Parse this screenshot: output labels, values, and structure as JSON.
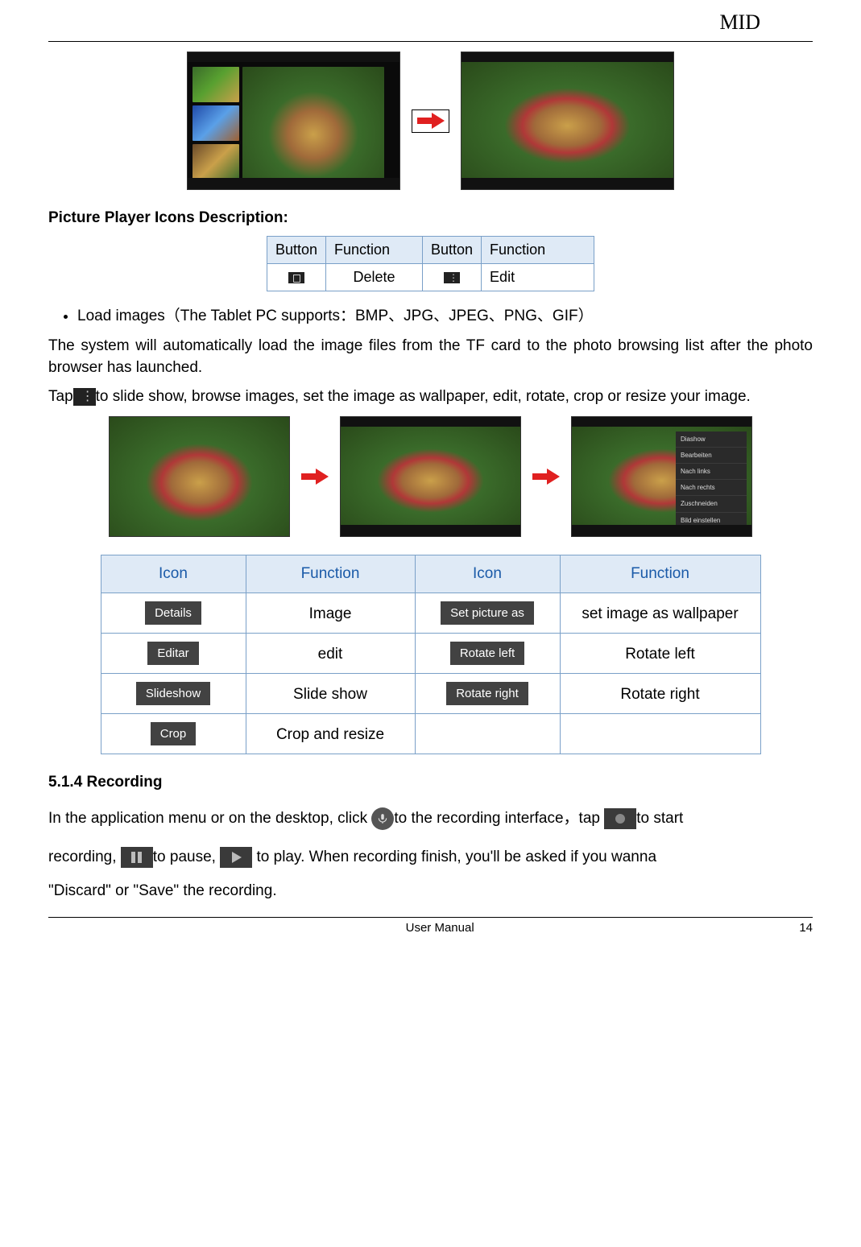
{
  "header": {
    "title": "MID"
  },
  "section_picture_desc": "Picture Player Icons Description:",
  "small_table": {
    "h1": "Button",
    "h2": "Function",
    "h3": "Button",
    "h4": "Function",
    "r1c2": "Delete",
    "r1c4": "Edit"
  },
  "bullet1": "Load images（The Tablet PC supports：BMP、JPG、JPEG、PNG、GIF）",
  "para1": "The system will automatically load the image files from the TF card to the photo browsing list after the photo browser has launched.",
  "para2_pre": "Tap",
  "para2_post": "to slide show, browse images, set the image as wallpaper, edit, rotate, crop or resize your image.",
  "big_table": {
    "h1": "Icon",
    "h2": "Function",
    "h3": "Icon",
    "h4": "Function",
    "rows": [
      {
        "icon1": "Details",
        "fn1": "Image",
        "icon2": "Set picture as",
        "fn2": "set image as wallpaper"
      },
      {
        "icon1": "Editar",
        "fn1": "edit",
        "icon2": "Rotate left",
        "fn2": "Rotate left"
      },
      {
        "icon1": "Slideshow",
        "fn1": "Slide show",
        "icon2": "Rotate right",
        "fn2": "Rotate right"
      },
      {
        "icon1": "Crop",
        "fn1": "Crop and resize",
        "icon2": "",
        "fn2": ""
      }
    ]
  },
  "section_514": "5.1.4 Recording",
  "rec_p1a": "In the application menu or on the desktop, click ",
  "rec_p1b": "to the recording interface，tap",
  "rec_p1c": "to start",
  "rec_p2a": "recording, ",
  "rec_p2b": "to pause,",
  "rec_p2c": " to play. When recording finish, you'll be asked if you wanna",
  "rec_p3": "\"Discard\" or \"Save\" the recording.",
  "footer": {
    "center": "User Manual",
    "page": "14"
  }
}
